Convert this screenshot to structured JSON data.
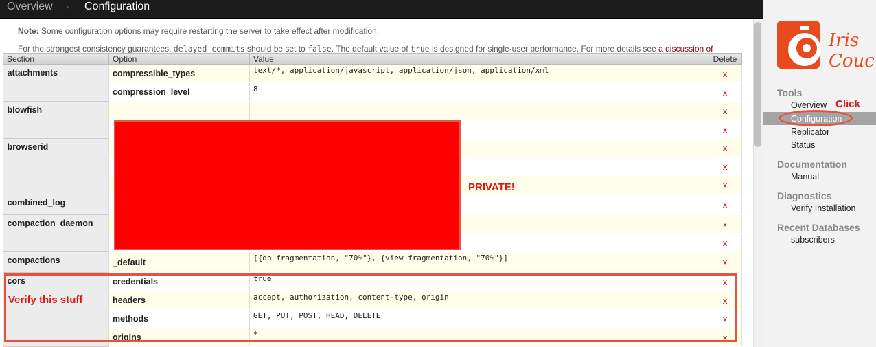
{
  "breadcrumb": {
    "overview": "Overview",
    "separator": "›",
    "current": "Configuration"
  },
  "note": {
    "label": "Note:",
    "text": "Some configuration options may require restarting the server to take effect after modification.",
    "line2_a": "For the strongest consistency guarantees,",
    "line2_code1": "delayed_commits",
    "line2_b": "should be set to",
    "line2_code2": "false",
    "line2_c": ". The default value of",
    "line2_code3": "true",
    "line2_d": "is designed for single-user performance. For more details see",
    "link": "a discussion of durability on the CouchDB wiki",
    "line2_end": "."
  },
  "table": {
    "headers": {
      "section": "Section",
      "option": "Option",
      "value": "Value",
      "delete": "Delete"
    },
    "delete_glyph": "x",
    "sections": {
      "attachments": "attachments",
      "blowfish": "blowfish",
      "browserid": "browserid",
      "combined_log": "combined_log",
      "compaction_daemon": "compaction_daemon",
      "compactions": "compactions",
      "cors": "cors"
    },
    "rows": [
      {
        "option": "compressible_types",
        "value": "text/*, application/javascript, application/json, application/xml"
      },
      {
        "option": "compression_level",
        "value": "8"
      },
      {
        "option": "",
        "value": ""
      },
      {
        "option": "",
        "value": ""
      },
      {
        "option": "",
        "value": ""
      },
      {
        "option": "",
        "value": ""
      },
      {
        "option": "",
        "value": ""
      },
      {
        "option": "",
        "value": ""
      },
      {
        "option": "",
        "value": ""
      },
      {
        "option": "",
        "value": ""
      },
      {
        "option": "_default",
        "value": "[{db_fragmentation, \"70%\"}, {view_fragmentation, \"70%\"}]"
      },
      {
        "option": "credentials",
        "value": "true"
      },
      {
        "option": "headers",
        "value": "accept, authorization, content-type, origin"
      },
      {
        "option": "methods",
        "value": "GET, PUT, POST, HEAD, DELETE"
      },
      {
        "option": "origins",
        "value": "*"
      }
    ]
  },
  "annotations": {
    "private": "PRIVATE!",
    "verify": "Verify this stuff",
    "click": "Click"
  },
  "sidebar": {
    "logo_text": "Iris Couch",
    "tools_heading": "Tools",
    "tools": [
      "Overview",
      "Configuration",
      "Replicator",
      "Status"
    ],
    "documentation_heading": "Documentation",
    "documentation": [
      "Manual"
    ],
    "diagnostics_heading": "Diagnostics",
    "diagnostics": [
      "Verify Installation"
    ],
    "recent_heading": "Recent Databases",
    "recent": [
      "subscribers"
    ]
  },
  "colors": {
    "accent": "#e8491d",
    "annotation": "#d61a1a",
    "redaction": "#ff0000",
    "delete": "#cc0000"
  }
}
